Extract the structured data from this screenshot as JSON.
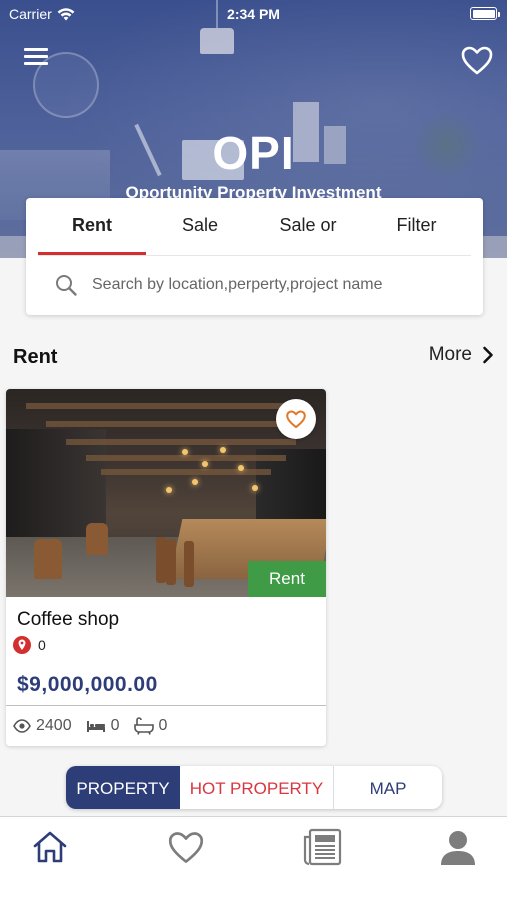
{
  "status_bar": {
    "carrier": "Carrier",
    "time": "2:34 PM"
  },
  "header": {
    "title": "OPI",
    "subtitle": "Oportunity Property Investment"
  },
  "search_card": {
    "tabs": [
      {
        "label": "Rent",
        "active": true
      },
      {
        "label": "Sale",
        "active": false
      },
      {
        "label": "Sale or",
        "active": false
      },
      {
        "label": "Filter",
        "active": false
      }
    ],
    "search_placeholder": "Search by location,perperty,project name"
  },
  "section": {
    "title": "Rent",
    "more_label": "More"
  },
  "listing": {
    "name": "Coffee shop",
    "location": "0",
    "price": "$9,000,000.00",
    "badge": "Rent",
    "views": "2400",
    "bedrooms": "0",
    "bathrooms": "0"
  },
  "segmented": {
    "property": "PROPERTY",
    "hot_property": "HOT PROPERTY",
    "map": "MAP",
    "selected": "PROPERTY"
  },
  "bottom_nav": {
    "items": [
      "home-icon",
      "heart-icon",
      "news-icon",
      "profile-icon"
    ],
    "active": "home-icon"
  },
  "colors": {
    "primary": "#2d3d78",
    "accent_red": "#d32f2f",
    "rent_badge": "#3f9b45",
    "hot_red": "#d9363e"
  }
}
